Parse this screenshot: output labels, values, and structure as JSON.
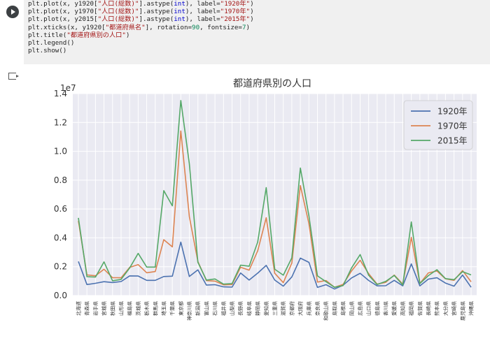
{
  "code_lines": [
    "plt.plot(x, y1920[\"人口(総数)\"].astype(int), label=\"1920年\")",
    "plt.plot(x, y1970[\"人口(総数)\"].astype(int), label=\"1970年\")",
    "plt.plot(x, y2015[\"人口(総数)\"].astype(int), label=\"2015年\")",
    "plt.xticks(x, y1920[\"都道府県名\"], rotation=90, fontsize=7)",
    "plt.title(\"都道府県別の人口\")",
    "plt.legend()",
    "plt.show()"
  ],
  "chart_data": {
    "type": "line",
    "title": "都道府県別の人口",
    "xlabel": "",
    "ylabel": "",
    "y_offset_label": "1e7",
    "ylim": [
      0,
      1.4
    ],
    "yticks": [
      "0.0",
      "0.2",
      "0.4",
      "0.6",
      "0.8",
      "1.0",
      "1.2",
      "1.4"
    ],
    "grid": true,
    "legend_position": "top-right",
    "categories": [
      "北海道",
      "青森県",
      "岩手県",
      "宮城県",
      "秋田県",
      "山形県",
      "福島県",
      "茨城県",
      "栃木県",
      "群馬県",
      "埼玉県",
      "千葉県",
      "東京都",
      "神奈川県",
      "新潟県",
      "富山県",
      "石川県",
      "福井県",
      "山梨県",
      "長野県",
      "岐阜県",
      "静岡県",
      "愛知県",
      "三重県",
      "滋賀県",
      "京都府",
      "大阪府",
      "兵庫県",
      "奈良県",
      "和歌山県",
      "鳥取県",
      "島根県",
      "岡山県",
      "広島県",
      "山口県",
      "徳島県",
      "香川県",
      "愛媛県",
      "高知県",
      "福岡県",
      "佐賀県",
      "長崎県",
      "熊本県",
      "大分県",
      "宮崎県",
      "鹿児島県",
      "沖縄県"
    ],
    "series": [
      {
        "name": "1920年",
        "color": "#4c72b0",
        "values": [
          0.236,
          0.076,
          0.085,
          0.096,
          0.09,
          0.097,
          0.136,
          0.135,
          0.105,
          0.105,
          0.132,
          0.134,
          0.37,
          0.132,
          0.178,
          0.072,
          0.075,
          0.06,
          0.058,
          0.156,
          0.107,
          0.155,
          0.209,
          0.107,
          0.065,
          0.129,
          0.259,
          0.23,
          0.056,
          0.075,
          0.045,
          0.071,
          0.122,
          0.154,
          0.104,
          0.067,
          0.068,
          0.105,
          0.067,
          0.219,
          0.067,
          0.114,
          0.123,
          0.086,
          0.065,
          0.142,
          0.057
        ]
      },
      {
        "name": "1970年",
        "color": "#dd8452",
        "values": [
          0.518,
          0.143,
          0.137,
          0.182,
          0.124,
          0.123,
          0.195,
          0.214,
          0.158,
          0.166,
          0.387,
          0.337,
          1.141,
          0.547,
          0.236,
          0.103,
          0.1,
          0.074,
          0.076,
          0.196,
          0.176,
          0.309,
          0.539,
          0.154,
          0.089,
          0.225,
          0.762,
          0.499,
          0.093,
          0.104,
          0.057,
          0.077,
          0.171,
          0.244,
          0.151,
          0.079,
          0.091,
          0.142,
          0.079,
          0.403,
          0.084,
          0.157,
          0.17,
          0.116,
          0.105,
          0.173,
          0.095
        ]
      },
      {
        "name": "2015年",
        "color": "#55a868",
        "values": [
          0.538,
          0.131,
          0.128,
          0.233,
          0.102,
          0.112,
          0.191,
          0.292,
          0.197,
          0.197,
          0.727,
          0.622,
          1.352,
          0.913,
          0.23,
          0.107,
          0.115,
          0.079,
          0.083,
          0.21,
          0.203,
          0.37,
          0.748,
          0.182,
          0.141,
          0.261,
          0.884,
          0.553,
          0.136,
          0.096,
          0.057,
          0.069,
          0.192,
          0.284,
          0.14,
          0.076,
          0.098,
          0.139,
          0.073,
          0.51,
          0.083,
          0.138,
          0.179,
          0.117,
          0.11,
          0.165,
          0.143
        ]
      }
    ]
  }
}
